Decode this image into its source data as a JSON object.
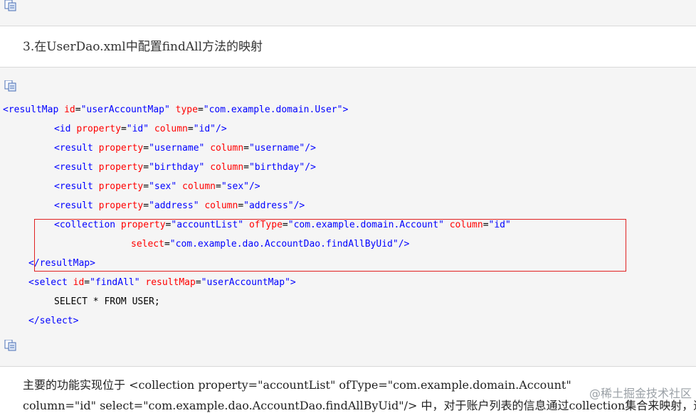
{
  "icons": {
    "copy": "copy-code-icon"
  },
  "heading": "3.在UserDao.xml中配置findAll方法的映射",
  "code": {
    "line1": {
      "open": "<resultMap ",
      "a1": "id",
      "e1": "=",
      "v1": "\"userAccountMap\"",
      "a2": "type",
      "e2": "=",
      "v2": "\"com.example.domain.User\"",
      "close": ">"
    },
    "line2": {
      "open": "<id ",
      "a1": "property",
      "e1": "=",
      "v1": "\"id\"",
      "a2": "column",
      "e2": "=",
      "v2": "\"id\"",
      "close": "/>"
    },
    "line3": {
      "open": "<result ",
      "a1": "property",
      "e1": "=",
      "v1": "\"username\"",
      "a2": "column",
      "e2": "=",
      "v2": "\"username\"",
      "close": "/>"
    },
    "line4": {
      "open": "<result ",
      "a1": "property",
      "e1": "=",
      "v1": "\"birthday\"",
      "a2": "column",
      "e2": "=",
      "v2": "\"birthday\"",
      "close": "/>"
    },
    "line5": {
      "open": "<result ",
      "a1": "property",
      "e1": "=",
      "v1": "\"sex\"",
      "a2": "column",
      "e2": "=",
      "v2": "\"sex\"",
      "close": "/>"
    },
    "line6": {
      "open": "<result ",
      "a1": "property",
      "e1": "=",
      "v1": "\"address\"",
      "a2": "column",
      "e2": "=",
      "v2": "\"address\"",
      "close": "/>"
    },
    "line7": {
      "open": "<collection ",
      "a1": "property",
      "e1": "=",
      "v1": "\"accountList\"",
      "a2": "ofType",
      "e2": "=",
      "v2": "\"com.example.domain.Account\"",
      "a3": "column",
      "e3": "=",
      "v3": "\"id\""
    },
    "line8": {
      "a1": "select",
      "e1": "=",
      "v1": "\"com.example.dao.AccountDao.findAllByUid\"",
      "close": "/>"
    },
    "line9": {
      "text": "</resultMap>"
    },
    "line10": {
      "open": "<select ",
      "a1": "id",
      "e1": "=",
      "v1": "\"findAll\"",
      "a2": "resultMap",
      "e2": "=",
      "v2": "\"userAccountMap\"",
      "close": ">"
    },
    "line11": {
      "text": "SELECT * FROM USER;"
    },
    "line12": {
      "text": "</select>"
    }
  },
  "paragraph": {
    "line1": "主要的功能实现位于 <collection property=\"accountList\" ofType=\"com.example.domain.Account\"",
    "line2": "column=\"id\" select=\"com.example.dao.AccountDao.findAllByUid\"/> 中，对于账户列表的信息通过collection集合来映射，通过"
  },
  "watermark": "@稀土掘金技术社区",
  "colors": {
    "tag": "#0000ff",
    "attr": "#ff0000",
    "value": "#0000ff",
    "highlight": "#e02020"
  }
}
